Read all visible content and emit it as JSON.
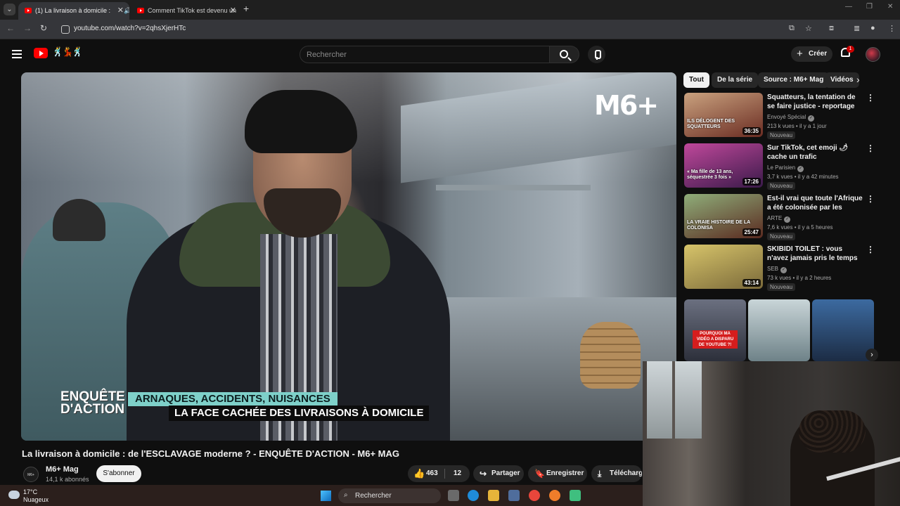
{
  "browser": {
    "tabs": [
      {
        "title": "(1) La livraison à domicile :",
        "active": true
      },
      {
        "title": "Comment TikTok est devenu un",
        "active": false
      }
    ],
    "url": "youtube.com/watch?v=2qhsXjerHTc"
  },
  "header": {
    "search_placeholder": "Rechercher",
    "create_label": "Créer",
    "notification_count": "1"
  },
  "video": {
    "overlay": {
      "channel_logo": "M6+",
      "show_logo": "ENQUÊTE D'ACTION",
      "lower_third_line1": "ARNAQUES, ACCIDENTS, NUISANCES",
      "lower_third_line2": "LA FACE CACHÉE DES LIVRAISONS À DOMICILE"
    },
    "title": "La livraison à domicile : de l'ESCLAVAGE moderne ? - ENQUÊTE D'ACTION - M6+ MAG",
    "channel": {
      "name": "M6+ Mag",
      "subscribers": "14,1 k abonnés",
      "avatar_text": "M6+ MAG"
    },
    "subscribe_label": "S'abonner",
    "likes": "463",
    "comments_count": "12",
    "share_label": "Partager",
    "save_label": "Enregistrer",
    "download_label": "Télécharger"
  },
  "sidebar": {
    "chips": [
      "Tout",
      "De la série",
      "Source : M6+ Mag",
      "Vidéos"
    ],
    "recommendations": [
      {
        "title": "Squatteurs, la tentation de se faire justice - reportage intégral",
        "channel": "Envoyé Spécial",
        "views": "213 k vues",
        "age": "il y a 1 jour",
        "badge": "Nouveau",
        "duration": "36:35",
        "thumb_text": "ILS DÉLOGENT DES SQUATTEURS",
        "thumb_color": "#8a3b2a"
      },
      {
        "title": "Sur TikTok, cet emoji 🌶 cache un trafic d'adolescentes",
        "channel": "Le Parisien",
        "views": "3,7 k vues",
        "age": "il y a 42 minutes",
        "badge": "Nouveau",
        "duration": "17:26",
        "thumb_text": "« Ma fille de 13 ans, séquestrée 3 fois »",
        "thumb_color": "#8e2a6a"
      },
      {
        "title": "Est-il vrai que toute l'Afrique a été colonisée par les Européen...",
        "channel": "ARTE",
        "views": "7,6 k vues",
        "age": "il y a 5 heures",
        "badge": "Nouveau",
        "duration": "25:47",
        "thumb_text": "LA VRAIE HISTOIRE DE LA COLONISA",
        "thumb_color": "#6f6a3e"
      },
      {
        "title": "SKIBIDI TOILET : vous n'avez jamais pris le temps de ...",
        "channel": "SEB",
        "views": "73 k vues",
        "age": "il y a 2 heures",
        "badge": "Nouveau",
        "duration": "43:14",
        "thumb_text": "",
        "thumb_color": "#c2a84a"
      }
    ],
    "shorts": [
      {
        "caption": "POURQUOI MA VIDÉO A DISPARU DE YOUTUBE ?!",
        "color": "#4a4f5c"
      },
      {
        "caption": "",
        "color": "#9fb2b8"
      },
      {
        "caption": "",
        "color": "#2f4f7a"
      }
    ]
  },
  "taskbar": {
    "temperature": "17°C",
    "weather": "Nuageux",
    "search_label": "Rechercher"
  }
}
